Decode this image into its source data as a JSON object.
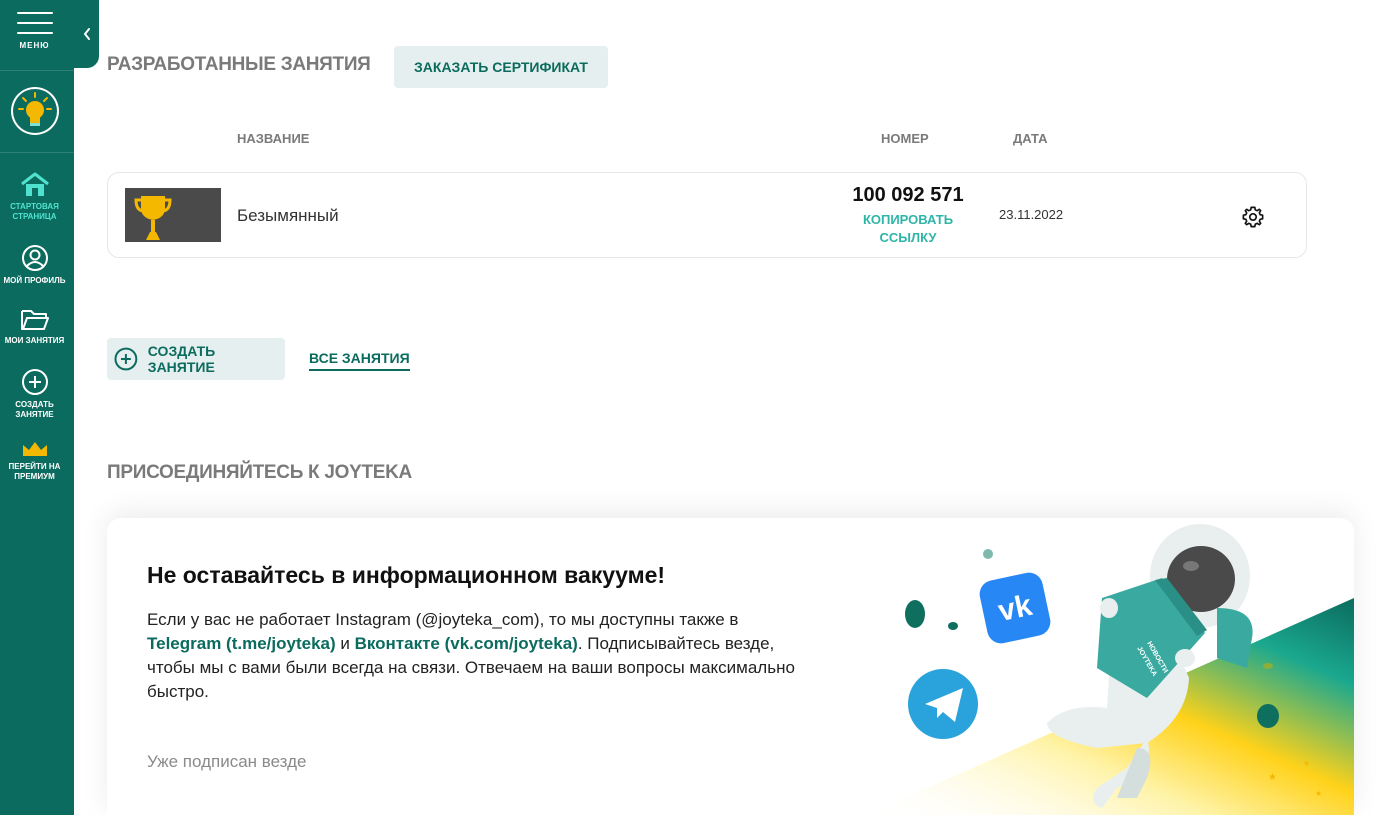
{
  "sidebar": {
    "menu_label": "МЕНЮ",
    "items": [
      {
        "label_line1": "СТАРТОВАЯ",
        "label_line2": "СТРАНИЦА",
        "icon": "home-icon",
        "active": true
      },
      {
        "label_line1": "МОЙ ПРОФИЛЬ",
        "label_line2": "",
        "icon": "user-circle-icon",
        "active": false
      },
      {
        "label_line1": "МОИ ЗАНЯТИЯ",
        "label_line2": "",
        "icon": "folder-icon",
        "active": false
      },
      {
        "label_line1": "СОЗДАТЬ",
        "label_line2": "ЗАНЯТИЕ",
        "icon": "plus-circle-icon",
        "active": false
      },
      {
        "label_line1": "ПЕРЕЙТИ НА",
        "label_line2": "ПРЕМИУМ",
        "icon": "crown-icon",
        "active": false
      }
    ]
  },
  "developed": {
    "title": "РАЗРАБОТАННЫЕ ЗАНЯТИЯ",
    "order_button": "ЗАКАЗАТЬ СЕРТИФИКАТ",
    "columns": {
      "name": "НАЗВАНИЕ",
      "number": "НОМЕР",
      "date": "ДАТА"
    },
    "rows": [
      {
        "name": "Безымянный",
        "number": "100 092 571",
        "copy_line1": "КОПИРОВАТЬ",
        "copy_line2": "ССЫЛКУ",
        "date": "23.11.2022"
      }
    ],
    "create_button": "СОЗДАТЬ ЗАНЯТИЕ",
    "all_link": "ВСЕ ЗАНЯТИЯ"
  },
  "join": {
    "title": "ПРИСОЕДИНЯЙТЕСЬ К JOYTEKA",
    "card_title": "Не оставайтесь в информационном вакууме!",
    "text_part1": "Если у вас не работает Instagram (@joyteka_com), то мы доступны также в ",
    "telegram_link": "Telegram (t.me/joyteka)",
    "text_and": " и ",
    "vk_link": "Вконтакте (vk.com/joyteka)",
    "text_part2": ". Подписывайтесь везде, чтобы мы с вами были всегда на связи. Отвечаем на ваши вопросы максимально быстро.",
    "subscribed_note": "Уже подписан везде",
    "book_text_line1": "НОВОСТИ",
    "book_text_line2": "JOYTEKA"
  },
  "colors": {
    "brand": "#0b6b5e",
    "accent": "#2fb5a8",
    "active_nav": "#4fe3cf",
    "premium": "#f5b800"
  }
}
